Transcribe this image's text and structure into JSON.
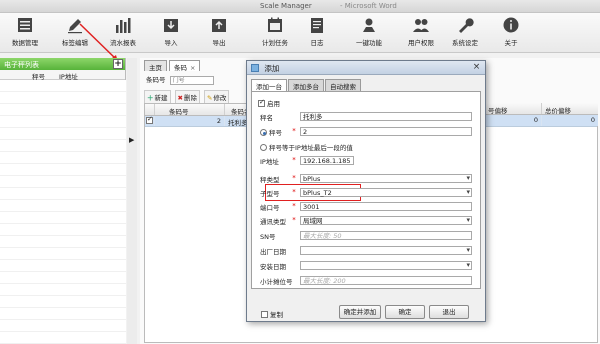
{
  "window": {
    "title": "Scale Manager",
    "title_suffix": "- Microsoft Word"
  },
  "toolbar": {
    "items": [
      {
        "label": "数据管理",
        "icon": "table-icon"
      },
      {
        "label": "标签编辑",
        "icon": "pen-icon"
      },
      {
        "label": "流水报表",
        "icon": "chart-bars-icon"
      },
      {
        "label": "导入",
        "icon": "import-icon"
      },
      {
        "label": "导出",
        "icon": "export-icon"
      },
      {
        "label": "计划任务",
        "icon": "calendar-icon"
      },
      {
        "label": "日志",
        "icon": "log-icon"
      },
      {
        "label": "一键功能",
        "icon": "one-key-icon"
      },
      {
        "label": "用户权限",
        "icon": "users-icon"
      },
      {
        "label": "系统设定",
        "icon": "wrench-icon"
      },
      {
        "label": "关于",
        "icon": "info-icon"
      }
    ]
  },
  "left_panel": {
    "title": "电子秤列表",
    "add_button": "+",
    "columns": [
      "秤号",
      "IP地址"
    ]
  },
  "main": {
    "tabs": [
      {
        "label": "主页"
      },
      {
        "label": "条码",
        "close": "×"
      }
    ],
    "search": {
      "label": "条码号",
      "placeholder": "门号"
    },
    "actions": [
      {
        "label": "新建",
        "icon": "plus-icon"
      },
      {
        "label": "删除",
        "icon": "delete-icon"
      },
      {
        "label": "修改",
        "icon": "edit-icon"
      }
    ],
    "table": {
      "columns": [
        "",
        "条码号",
        "条码名称"
      ],
      "rows": [
        {
          "checked": true,
          "number": "2",
          "name": "托利多计"
        }
      ]
    },
    "right_columns": {
      "headers": [
        "号偏移",
        "总价偏移"
      ],
      "row": [
        "0",
        "0"
      ]
    }
  },
  "dialog": {
    "title": "添加",
    "close": "×",
    "tabs": [
      "添加一台",
      "添加多台",
      "自动搜索"
    ],
    "enabled_label": "启用",
    "fields": {
      "name": {
        "label": "秤名",
        "value": "托利多"
      },
      "scale_number": {
        "label": "秤号",
        "value": "2"
      },
      "scale_equals_ip": {
        "label": "秤号等于IP地址最后一段的值"
      },
      "ip": {
        "label": "IP地址",
        "value": "192.168.1.185"
      },
      "scale_type": {
        "label": "秤类型",
        "value": "bPlus"
      },
      "sub_model": {
        "label": "子型号",
        "value": "bPlus_T2"
      },
      "port": {
        "label": "端口号",
        "value": "3001"
      },
      "comm_type": {
        "label": "通讯类型",
        "value": "局域网"
      },
      "sn": {
        "label": "SN号",
        "placeholder": "最大长度: 50"
      },
      "factory_date": {
        "label": "出厂日期",
        "value": ""
      },
      "install_date": {
        "label": "安装日期",
        "value": ""
      },
      "cashier_no": {
        "label": "小计摊位号",
        "placeholder": "最大长度: 200"
      }
    },
    "copy_label": "复制",
    "buttons": {
      "confirm_add": "确定并添加",
      "ok": "确定",
      "cancel": "退出"
    }
  }
}
